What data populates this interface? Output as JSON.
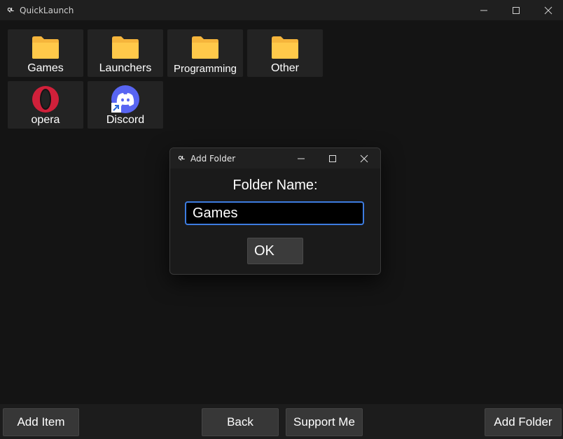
{
  "window": {
    "title": "QuickLaunch",
    "logo_text": "QL",
    "accent": "#3d7ce0"
  },
  "tiles": [
    {
      "label": "Games",
      "icon": "folder-icon"
    },
    {
      "label": "Launchers",
      "icon": "folder-icon"
    },
    {
      "label": "Programming",
      "icon": "folder-icon"
    },
    {
      "label": "Other",
      "icon": "folder-icon"
    },
    {
      "label": "opera",
      "icon": "opera-icon"
    },
    {
      "label": "Discord",
      "icon": "discord-icon"
    }
  ],
  "dialog": {
    "title": "Add Folder",
    "logo_text": "QL",
    "prompt": "Folder Name:",
    "input_value": "Games",
    "ok_label": "OK"
  },
  "bottom": {
    "add_item": "Add Item",
    "back": "Back",
    "support": "Support Me",
    "add_folder": "Add Folder"
  }
}
